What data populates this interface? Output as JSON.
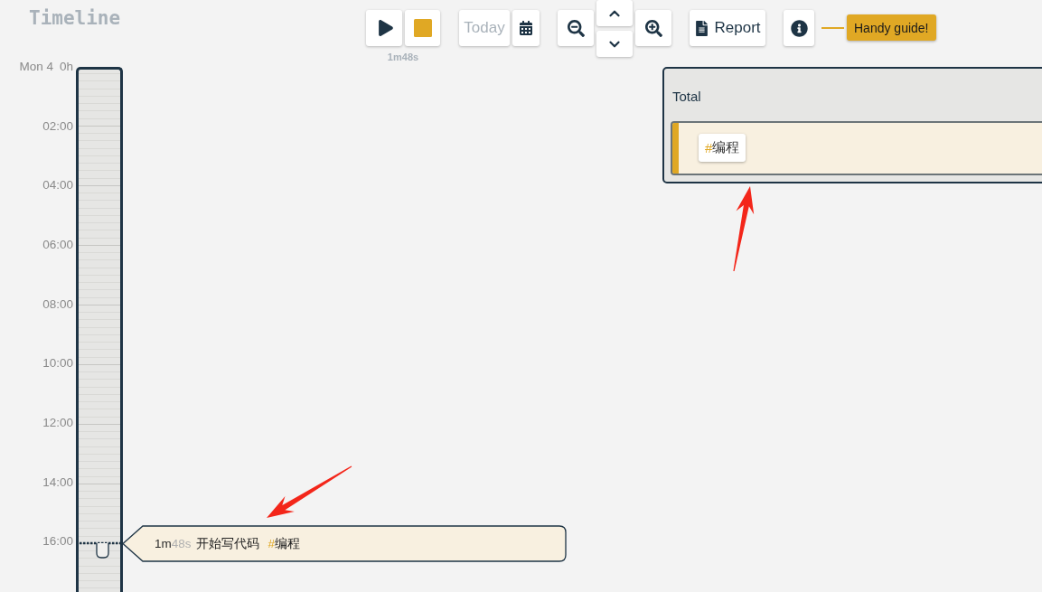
{
  "header": {
    "title": "Timeline"
  },
  "toolbar": {
    "elapsed": "1m48s",
    "today": {
      "label": "Today",
      "disabled": true
    },
    "report": {
      "label": "Report"
    },
    "guide": {
      "label": "Handy guide!"
    }
  },
  "timeline": {
    "day": "Mon 4",
    "start": "0h",
    "hours": [
      "02:00",
      "04:00",
      "06:00",
      "08:00",
      "10:00",
      "12:00",
      "14:00",
      "16:00"
    ],
    "events": [
      {
        "minutes": "1m",
        "seconds": "48s",
        "title": "开始写代码",
        "tags": [
          {
            "prefix": "#",
            "name": "编程"
          }
        ]
      }
    ]
  },
  "totals": {
    "title": "Total",
    "rows": [
      {
        "color": "#e0a824",
        "tags": [
          {
            "prefix": "#",
            "name": "编程"
          }
        ]
      }
    ]
  }
}
